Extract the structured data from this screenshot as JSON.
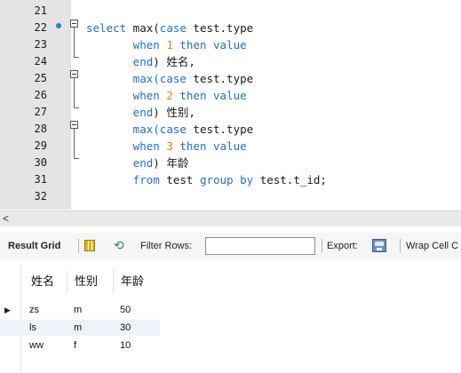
{
  "editor": {
    "lines": [
      {
        "no": "21",
        "parts": []
      },
      {
        "no": "22",
        "parts": [
          {
            "t": "select",
            "c": "kw"
          },
          {
            "t": " max(",
            "c": ""
          },
          {
            "t": "case",
            "c": "kw"
          },
          {
            "t": " test.type",
            "c": ""
          }
        ]
      },
      {
        "no": "23",
        "parts": [
          {
            "t": "       when ",
            "c": "kw"
          },
          {
            "t": "1",
            "c": "num"
          },
          {
            "t": " then",
            "c": "kw"
          },
          {
            "t": " value",
            "c": "kw"
          }
        ]
      },
      {
        "no": "24",
        "parts": [
          {
            "t": "       end",
            "c": "kw"
          },
          {
            "t": ") 姓名,",
            "c": ""
          }
        ]
      },
      {
        "no": "25",
        "parts": [
          {
            "t": "       max(",
            "c": "kw"
          },
          {
            "t": "case",
            "c": "kw"
          },
          {
            "t": " test.type",
            "c": ""
          }
        ]
      },
      {
        "no": "26",
        "parts": [
          {
            "t": "       when ",
            "c": "kw"
          },
          {
            "t": "2",
            "c": "num"
          },
          {
            "t": " then",
            "c": "kw"
          },
          {
            "t": " value",
            "c": "kw"
          }
        ]
      },
      {
        "no": "27",
        "parts": [
          {
            "t": "       end",
            "c": "kw"
          },
          {
            "t": ") 性别,",
            "c": ""
          }
        ]
      },
      {
        "no": "28",
        "parts": [
          {
            "t": "       max(",
            "c": "kw"
          },
          {
            "t": "case",
            "c": "kw"
          },
          {
            "t": " test.type",
            "c": ""
          }
        ]
      },
      {
        "no": "29",
        "parts": [
          {
            "t": "       when ",
            "c": "kw"
          },
          {
            "t": "3",
            "c": "num"
          },
          {
            "t": " then",
            "c": "kw"
          },
          {
            "t": " value",
            "c": "kw"
          }
        ]
      },
      {
        "no": "30",
        "parts": [
          {
            "t": "       end",
            "c": "kw"
          },
          {
            "t": ") 年龄",
            "c": ""
          }
        ]
      },
      {
        "no": "31",
        "parts": [
          {
            "t": "       from",
            "c": "kw"
          },
          {
            "t": " test ",
            "c": ""
          },
          {
            "t": "group by",
            "c": "kw"
          },
          {
            "t": " test.t_id;",
            "c": ""
          }
        ]
      },
      {
        "no": "32",
        "parts": []
      }
    ]
  },
  "scrollbar": {
    "left_arrow": "<"
  },
  "toolbar": {
    "result_grid_label": "Result Grid",
    "filter_rows_label": "Filter Rows:",
    "filter_value": "",
    "export_label": "Export:",
    "wrap_label": "Wrap Cell C"
  },
  "grid": {
    "columns": [
      "姓名",
      "性别",
      "年龄"
    ],
    "rows": [
      [
        "zs",
        "m",
        "50"
      ],
      [
        "ls",
        "m",
        "30"
      ],
      [
        "ww",
        "f",
        "10"
      ]
    ],
    "current_row_marker": "▶"
  },
  "colors": {
    "keyword": "#1e6fd0",
    "number": "#f08000",
    "breakpoint": "#1c84d8"
  }
}
